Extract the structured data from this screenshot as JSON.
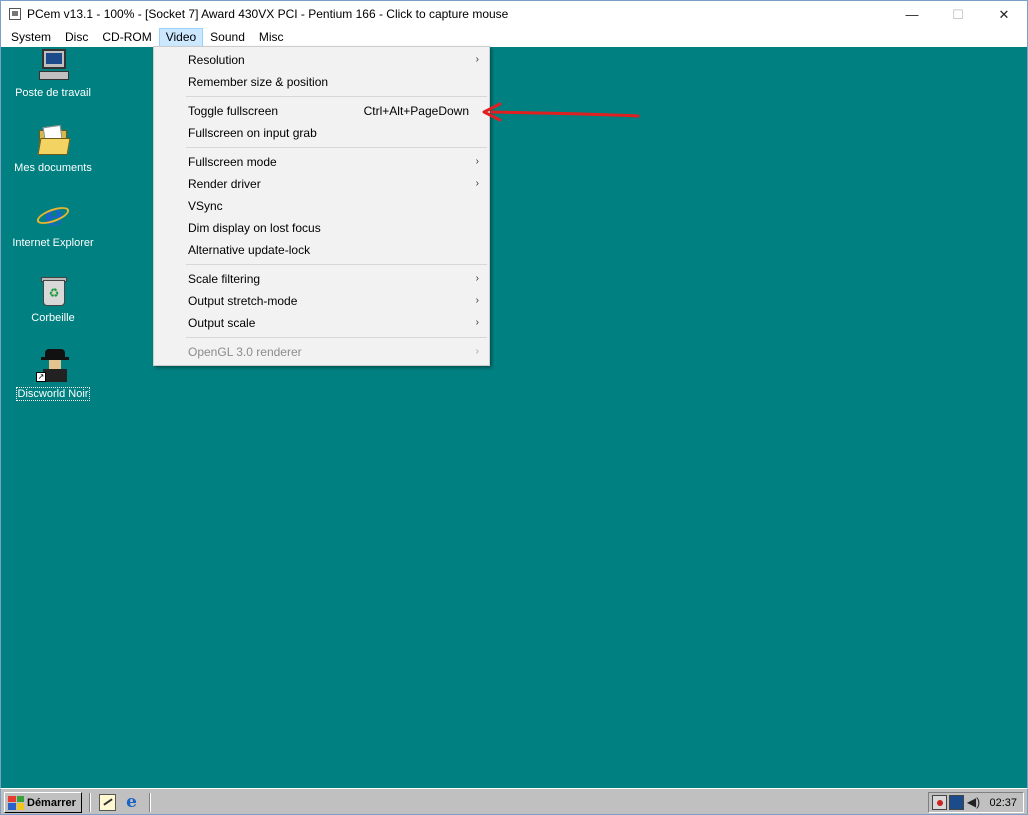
{
  "window": {
    "title": "PCem v13.1 - 100% - [Socket 7] Award 430VX PCI - Pentium 166 - Click to capture mouse",
    "minimize_glyph": "—",
    "maximize_glyph": "☐",
    "close_glyph": "✕"
  },
  "menubar": {
    "items": [
      {
        "label": "System"
      },
      {
        "label": "Disc"
      },
      {
        "label": "CD-ROM"
      },
      {
        "label": "Video",
        "active": true
      },
      {
        "label": "Sound"
      },
      {
        "label": "Misc"
      }
    ]
  },
  "video_menu": {
    "items": [
      {
        "label": "Resolution",
        "submenu": true
      },
      {
        "label": "Remember size & position"
      },
      {
        "label": "Toggle fullscreen",
        "shortcut": "Ctrl+Alt+PageDown"
      },
      {
        "label": "Fullscreen on input grab"
      },
      {
        "label": "Fullscreen mode",
        "submenu": true
      },
      {
        "label": "Render driver",
        "submenu": true
      },
      {
        "label": "VSync"
      },
      {
        "label": "Dim display on lost focus"
      },
      {
        "label": "Alternative update-lock"
      },
      {
        "label": "Scale filtering",
        "submenu": true
      },
      {
        "label": "Output stretch-mode",
        "submenu": true
      },
      {
        "label": "Output scale",
        "submenu": true
      },
      {
        "label": "OpenGL 3.0 renderer",
        "submenu": true,
        "disabled": true
      }
    ],
    "submenu_arrow": "›"
  },
  "desktop": {
    "background_color": "#008080",
    "icons": [
      {
        "label": "Poste de travail",
        "icon": "my-computer-icon"
      },
      {
        "label": "Mes documents",
        "icon": "my-documents-icon"
      },
      {
        "label": "Internet Explorer",
        "icon": "internet-explorer-icon"
      },
      {
        "label": "Corbeille",
        "icon": "recycle-bin-icon"
      },
      {
        "label": "Discworld Noir",
        "icon": "discworld-noir-icon",
        "selected": true
      }
    ]
  },
  "annotation": {
    "color": "#e02020",
    "icon": "red-arrow-icon"
  },
  "taskbar": {
    "start_label": "Démarrer",
    "quick_launch": [
      "show-desktop-icon",
      "internet-explorer-icon"
    ],
    "tray_icons": [
      "network-icon",
      "display-icon",
      "volume-icon"
    ],
    "volume_glyph": "◀)",
    "clock": "02:37"
  }
}
